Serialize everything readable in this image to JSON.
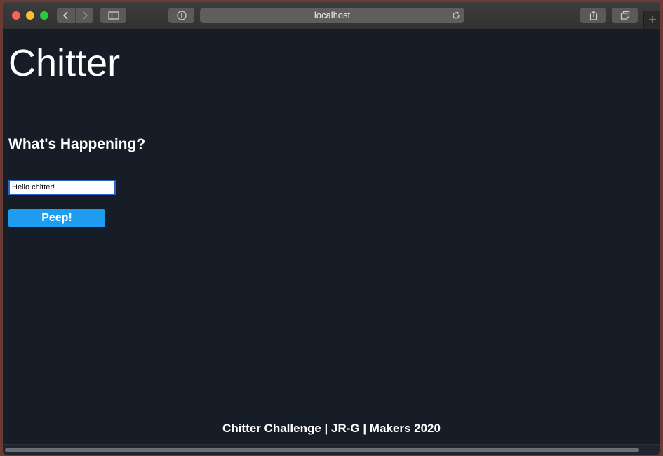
{
  "browser": {
    "address": "localhost",
    "icons": {
      "back": "chevron-left-icon",
      "forward": "chevron-right-icon",
      "sidebar": "sidebar-icon",
      "privacy": "shield-icon",
      "reload": "reload-icon",
      "share": "share-icon",
      "tabs": "tabs-icon",
      "new_tab": "plus-icon"
    }
  },
  "page": {
    "title": "Chitter",
    "prompt": "What's Happening?",
    "peep_input_value": "Hello chitter!",
    "peep_button_label": "Peep!",
    "footer": "Chitter Challenge | JR-G | Makers 2020"
  },
  "colors": {
    "background": "#161d26",
    "button": "#1f9cf0",
    "text": "#ffffff"
  }
}
